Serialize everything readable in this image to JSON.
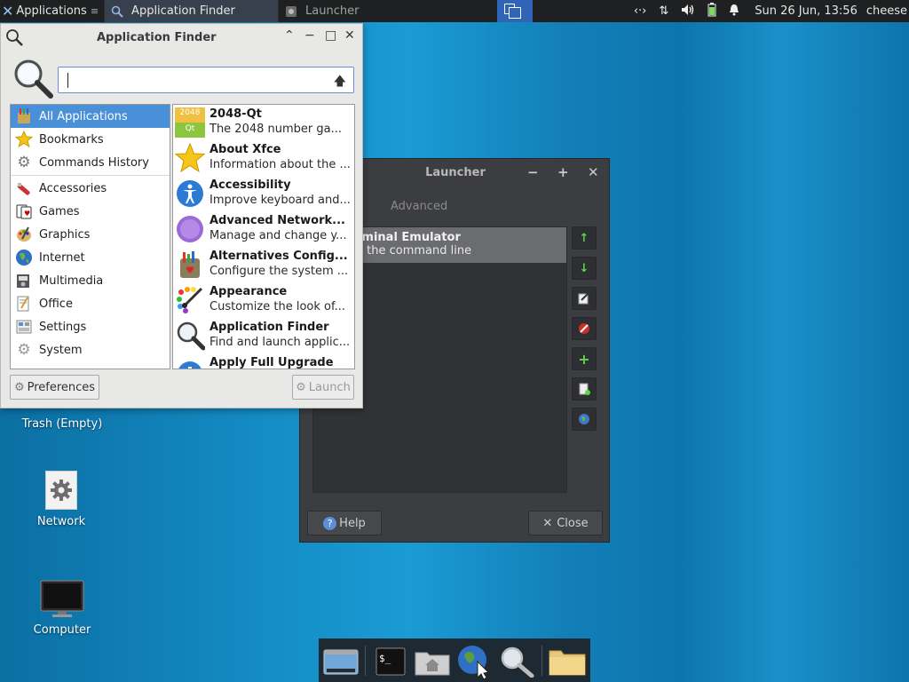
{
  "top_panel": {
    "applications_label": "Applications",
    "tasks": [
      {
        "label": "Application Finder",
        "active": true
      },
      {
        "label": "Launcher",
        "active": false
      }
    ],
    "clock": "Sun 26 Jun, 13:56",
    "user": "cheese"
  },
  "desktop": {
    "icons": [
      {
        "label": "Trash (Empty)"
      },
      {
        "label": "Network"
      },
      {
        "label": "Computer"
      }
    ]
  },
  "app_finder": {
    "title": "Application Finder",
    "search": {
      "value": "",
      "placeholder": ""
    },
    "categories": [
      {
        "label": "All Applications",
        "icon": "all-apps-icon",
        "selected": true
      },
      {
        "label": "Bookmarks",
        "icon": "star-icon"
      },
      {
        "label": "Commands History",
        "icon": "gears-icon"
      },
      {
        "label": "Accessories",
        "icon": "accessories-icon"
      },
      {
        "label": "Games",
        "icon": "games-icon"
      },
      {
        "label": "Graphics",
        "icon": "graphics-icon"
      },
      {
        "label": "Internet",
        "icon": "globe-icon"
      },
      {
        "label": "Multimedia",
        "icon": "multimedia-icon"
      },
      {
        "label": "Office",
        "icon": "office-icon"
      },
      {
        "label": "Settings",
        "icon": "settings-icon"
      },
      {
        "label": "System",
        "icon": "system-icon"
      }
    ],
    "apps": [
      {
        "name": "2048-Qt",
        "desc": "The 2048 number ga...",
        "icon": "2048-icon"
      },
      {
        "name": "About Xfce",
        "desc": "Information about the ...",
        "icon": "star-icon"
      },
      {
        "name": "Accessibility",
        "desc": "Improve keyboard and...",
        "icon": "accessibility-icon"
      },
      {
        "name": "Advanced Network...",
        "desc": "Manage and change y...",
        "icon": "network-icon"
      },
      {
        "name": "Alternatives Config...",
        "desc": "Configure the system ...",
        "icon": "alternatives-icon"
      },
      {
        "name": "Appearance",
        "desc": "Customize the look of...",
        "icon": "appearance-icon"
      },
      {
        "name": "Application Finder",
        "desc": "Find and launch applic...",
        "icon": "search-icon"
      },
      {
        "name": "Apply Full Upgrade",
        "desc": "",
        "icon": "upgrade-icon"
      }
    ],
    "preferences_label": "Preferences",
    "launch_label": "Launch",
    "icon_2048_top": "2048",
    "icon_2048_bottom": "Qt"
  },
  "launcher": {
    "title": "Launcher",
    "tab_advanced": "Advanced",
    "item_name": "rminal Emulator",
    "item_desc": "e the command line",
    "help_label": "Help",
    "close_label": "Close"
  },
  "colors": {
    "selection": "#4a90d9",
    "panel": "#1f2022",
    "accent_green": "#5fd54a"
  }
}
